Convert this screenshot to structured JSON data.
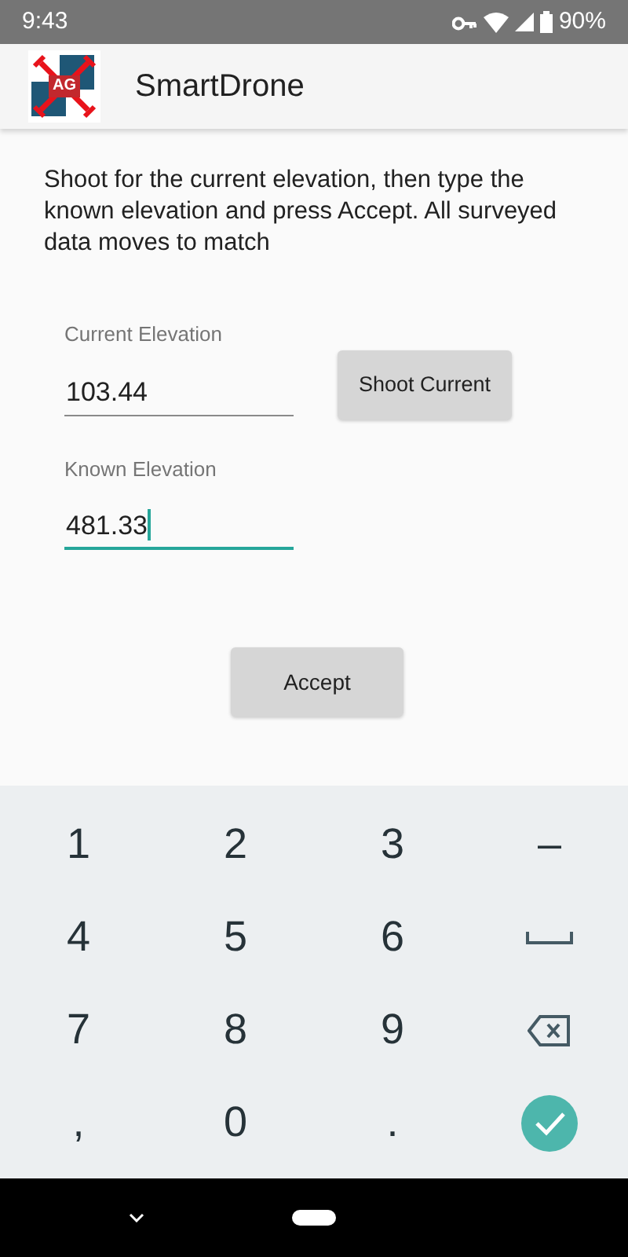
{
  "status_bar": {
    "time": "9:43",
    "battery": "90%"
  },
  "app_bar": {
    "logo_text": "AG",
    "title": "SmartDrone"
  },
  "instructions": "Shoot for the current elevation, then type the known elevation and press Accept. All surveyed data moves to match",
  "fields": [
    {
      "label": "Current Elevation",
      "value": "103.44",
      "focused": false
    },
    {
      "label": "Known Elevation",
      "value": "481.33",
      "focused": true
    }
  ],
  "shoot_button": "Shoot Current",
  "accept_button": "Accept",
  "keyboard": [
    {
      "kind": "text",
      "label": "1"
    },
    {
      "kind": "text",
      "label": "2"
    },
    {
      "kind": "text",
      "label": "3"
    },
    {
      "kind": "text",
      "label": "–"
    },
    {
      "kind": "text",
      "label": "4"
    },
    {
      "kind": "text",
      "label": "5"
    },
    {
      "kind": "text",
      "label": "6"
    },
    {
      "kind": "space"
    },
    {
      "kind": "text",
      "label": "7"
    },
    {
      "kind": "text",
      "label": "8"
    },
    {
      "kind": "text",
      "label": "9"
    },
    {
      "kind": "backspace"
    },
    {
      "kind": "text",
      "label": ","
    },
    {
      "kind": "text",
      "label": "0"
    },
    {
      "kind": "text",
      "label": "."
    },
    {
      "kind": "enter"
    }
  ]
}
